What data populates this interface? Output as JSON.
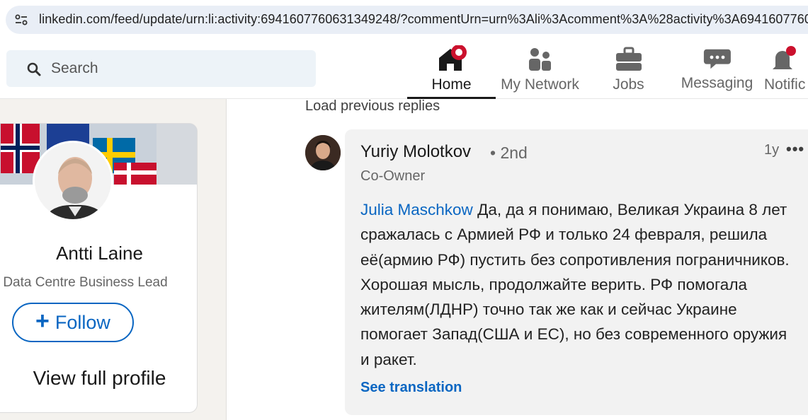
{
  "browser": {
    "url": "linkedin.com/feed/update/urn:li:activity:6941607760631349248/?commentUrn=urn%3Ali%3Acomment%3A%28activity%3A69416077606313",
    "site_icon": "tune-icon"
  },
  "nav": {
    "search_placeholder": "Search",
    "items": [
      {
        "label": "Home",
        "icon": "home-icon"
      },
      {
        "label": "My Network",
        "icon": "network-icon"
      },
      {
        "label": "Jobs",
        "icon": "briefcase-icon"
      },
      {
        "label": "Messaging",
        "icon": "messaging-icon"
      },
      {
        "label": "Notific",
        "icon": "bell-icon"
      }
    ]
  },
  "profile_card": {
    "name": "Antti Laine",
    "title": "Data Centre Business Lead",
    "follow_label": "Follow",
    "view_profile_label": "View full profile"
  },
  "comments": {
    "load_previous": "Load previous replies",
    "items": [
      {
        "author": "Yuriy Molotkov",
        "degree": "• 2nd",
        "role": "Co-Owner",
        "time": "1y",
        "mention": "Julia Maschkow",
        "text": "Да, да я понимаю, Великая Украина 8 лет сражалась с Армией РФ и только 24 февраля, решила её(армию РФ) пустить без сопротивления пограничников. Хорошая мысль, продолжайте верить. РФ помогала жителям(ЛДНР) точно так же как и сейчас Украине помогает Запад(США и ЕС), но без современного оружия и ракет.",
        "translate_label": "See translation"
      }
    ]
  },
  "colors": {
    "link": "#0a66c2",
    "notification_badge": "#cb112d"
  }
}
